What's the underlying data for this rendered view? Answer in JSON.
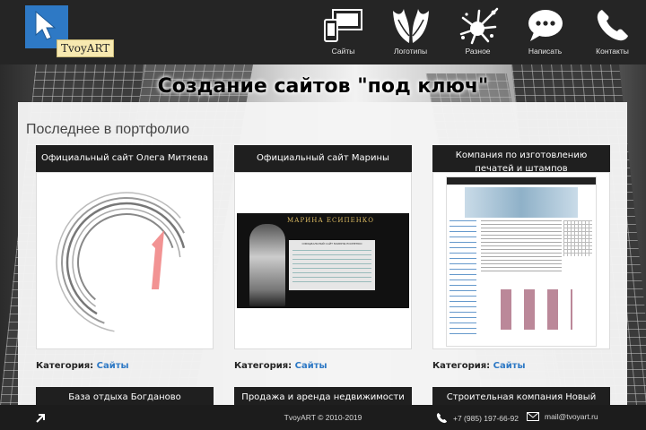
{
  "logo": {
    "text": "TvoyART"
  },
  "nav": [
    {
      "label": "Сайты",
      "icon": "screens-icon"
    },
    {
      "label": "Логотипы",
      "icon": "wings-icon"
    },
    {
      "label": "Разное",
      "icon": "splash-icon"
    },
    {
      "label": "Написать",
      "icon": "chat-bubble-icon"
    },
    {
      "label": "Контакты",
      "icon": "phone-icon"
    }
  ],
  "page": {
    "title": "Создание сайтов \"под ключ\"",
    "section_title": "Последнее в портфолио"
  },
  "portfolio": [
    {
      "title": "Официальный сайт Олега Митяева",
      "category_label": "Категория:",
      "category": "Сайты"
    },
    {
      "title": "Официальный сайт Марины Есипенко",
      "category_label": "Категория:",
      "category": "Сайты",
      "thumb_heading": "МАРИНА ЕСИПЕНКО",
      "thumb_subheading": "ОФИЦИАЛЬНЫЙ САЙТ МАРИНЫ ЕСИПЕНКО"
    },
    {
      "title": "Компания по изготовлению печатей и штампов",
      "category_label": "Категория:",
      "category": "Сайты"
    },
    {
      "title": "База отдыха Богданово"
    },
    {
      "title": "Продажа и аренда недвижимости в Болгарии"
    },
    {
      "title": "Строительная компания Новый Формат"
    }
  ],
  "footer": {
    "copyright": "TvoyART © 2010-2019",
    "phone": "+7 (985) 197-66-92",
    "email": "mail@tvoyart.ru"
  },
  "colors": {
    "accent": "#2e79c5",
    "header_bg": "#252525",
    "card_head_bg": "#1f1f1f"
  }
}
